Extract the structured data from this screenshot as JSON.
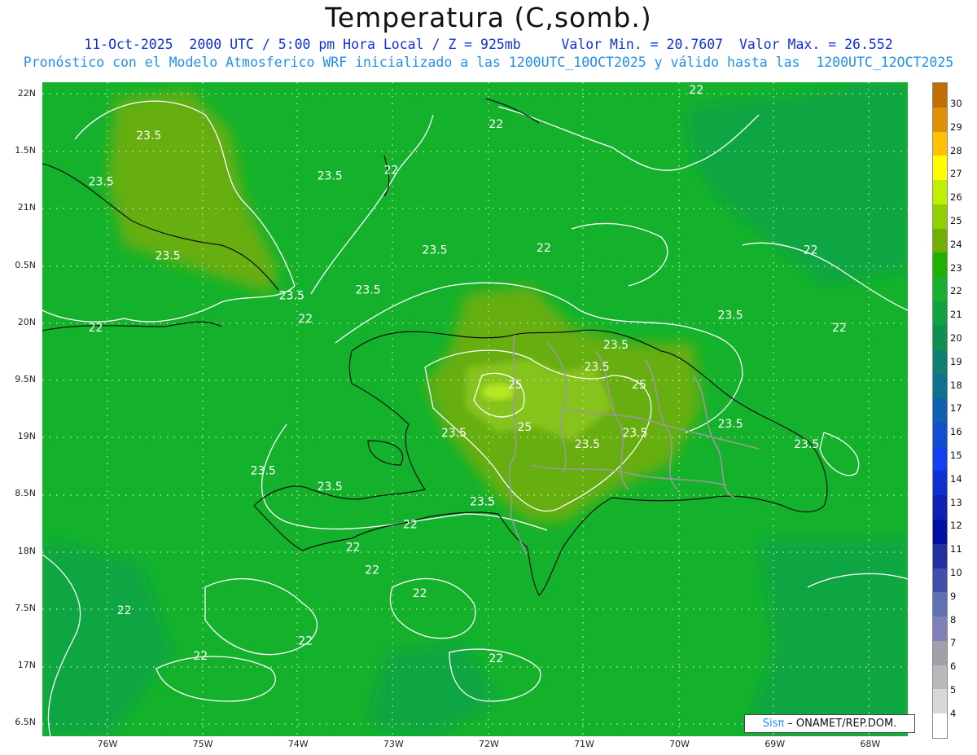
{
  "title": "Temperatura (C,somb.)",
  "subtitle_line1": "11-Oct-2025  2000 UTC / 5:00 pm Hora Local / Z = 925mb     Valor Min. = 20.7607  Valor Max. = 26.552",
  "subtitle_line2": "Pronóstico con el Modelo Atmosferico WRF inicializado a las 1200UTC_10OCT2025 y válido hasta las  1200UTC_12OCT2025",
  "credit": {
    "logo": "Sisπ",
    "text": " – ONAMET/REP.DOM."
  },
  "lat_labels": [
    "22N",
    "1.5N",
    "21N",
    "0.5N",
    "20N",
    "9.5N",
    "19N",
    "8.5N",
    "18N",
    "7.5N",
    "17N",
    "6.5N"
  ],
  "lon_labels": [
    "76W",
    "75W",
    "74W",
    "73W",
    "72W",
    "71W",
    "70W",
    "69W",
    "68W"
  ],
  "colorbar": {
    "values": [
      "30",
      "29",
      "28",
      "27",
      "26",
      "25",
      "24",
      "23",
      "22",
      "21",
      "20",
      "19",
      "18",
      "17",
      "16",
      "15",
      "14",
      "13",
      "12",
      "11",
      "10",
      "9",
      "8",
      "7",
      "6",
      "5",
      "4"
    ],
    "colors": [
      "#c07000",
      "#e09000",
      "#ffc000",
      "#ffff00",
      "#c0f000",
      "#90d000",
      "#70b000",
      "#20b000",
      "#18b030",
      "#10a040",
      "#109050",
      "#108070",
      "#107090",
      "#1060b0",
      "#1050d0",
      "#1040f0",
      "#1030d0",
      "#1020b0",
      "#0010a0",
      "#2030a0",
      "#4050a8",
      "#6070b0",
      "#8080b8",
      "#a0a0a8",
      "#b8b8b8",
      "#d8d8d8",
      "#ffffff"
    ]
  },
  "contour_labels": [
    {
      "text": "23.5",
      "lon": -75.7,
      "lat": 21.6
    },
    {
      "text": "23.5",
      "lon": -76.2,
      "lat": 21.2
    },
    {
      "text": "23.5",
      "lon": -73.8,
      "lat": 21.25
    },
    {
      "text": "22",
      "lon": -73.1,
      "lat": 21.3
    },
    {
      "text": "22",
      "lon": -72.0,
      "lat": 21.7
    },
    {
      "text": "22",
      "lon": -69.9,
      "lat": 22.0
    },
    {
      "text": "23.5",
      "lon": -75.5,
      "lat": 20.55
    },
    {
      "text": "23.5",
      "lon": -74.2,
      "lat": 20.2
    },
    {
      "text": "23.5",
      "lon": -72.7,
      "lat": 20.6
    },
    {
      "text": "22",
      "lon": -71.5,
      "lat": 20.62
    },
    {
      "text": "22",
      "lon": -68.7,
      "lat": 20.6
    },
    {
      "text": "23.5",
      "lon": -73.4,
      "lat": 20.25
    },
    {
      "text": "22",
      "lon": -74.0,
      "lat": 20.0
    },
    {
      "text": "22",
      "lon": -76.2,
      "lat": 19.92
    },
    {
      "text": "23.5",
      "lon": -69.6,
      "lat": 20.03
    },
    {
      "text": "22",
      "lon": -68.4,
      "lat": 19.92
    },
    {
      "text": "23.5",
      "lon": -70.8,
      "lat": 19.77
    },
    {
      "text": "23.5",
      "lon": -71.0,
      "lat": 19.58
    },
    {
      "text": "25",
      "lon": -71.8,
      "lat": 19.42
    },
    {
      "text": "25",
      "lon": -70.5,
      "lat": 19.42
    },
    {
      "text": "23.5",
      "lon": -72.5,
      "lat": 19.0
    },
    {
      "text": "25",
      "lon": -71.7,
      "lat": 19.05
    },
    {
      "text": "23.5",
      "lon": -71.1,
      "lat": 18.9
    },
    {
      "text": "23.5",
      "lon": -70.6,
      "lat": 19.0
    },
    {
      "text": "23.5",
      "lon": -69.6,
      "lat": 19.08
    },
    {
      "text": "23.5",
      "lon": -68.8,
      "lat": 18.9
    },
    {
      "text": "23.5",
      "lon": -74.5,
      "lat": 18.67
    },
    {
      "text": "23.5",
      "lon": -73.8,
      "lat": 18.53
    },
    {
      "text": "23.5",
      "lon": -72.2,
      "lat": 18.4
    },
    {
      "text": "22",
      "lon": -72.9,
      "lat": 18.2
    },
    {
      "text": "22",
      "lon": -73.5,
      "lat": 18.0
    },
    {
      "text": "22",
      "lon": -73.3,
      "lat": 17.8
    },
    {
      "text": "22",
      "lon": -72.8,
      "lat": 17.6
    },
    {
      "text": "22",
      "lon": -75.9,
      "lat": 17.45
    },
    {
      "text": "22",
      "lon": -74.0,
      "lat": 17.18
    },
    {
      "text": "22",
      "lon": -75.1,
      "lat": 17.05
    },
    {
      "text": "22",
      "lon": -72.0,
      "lat": 17.03
    }
  ]
}
